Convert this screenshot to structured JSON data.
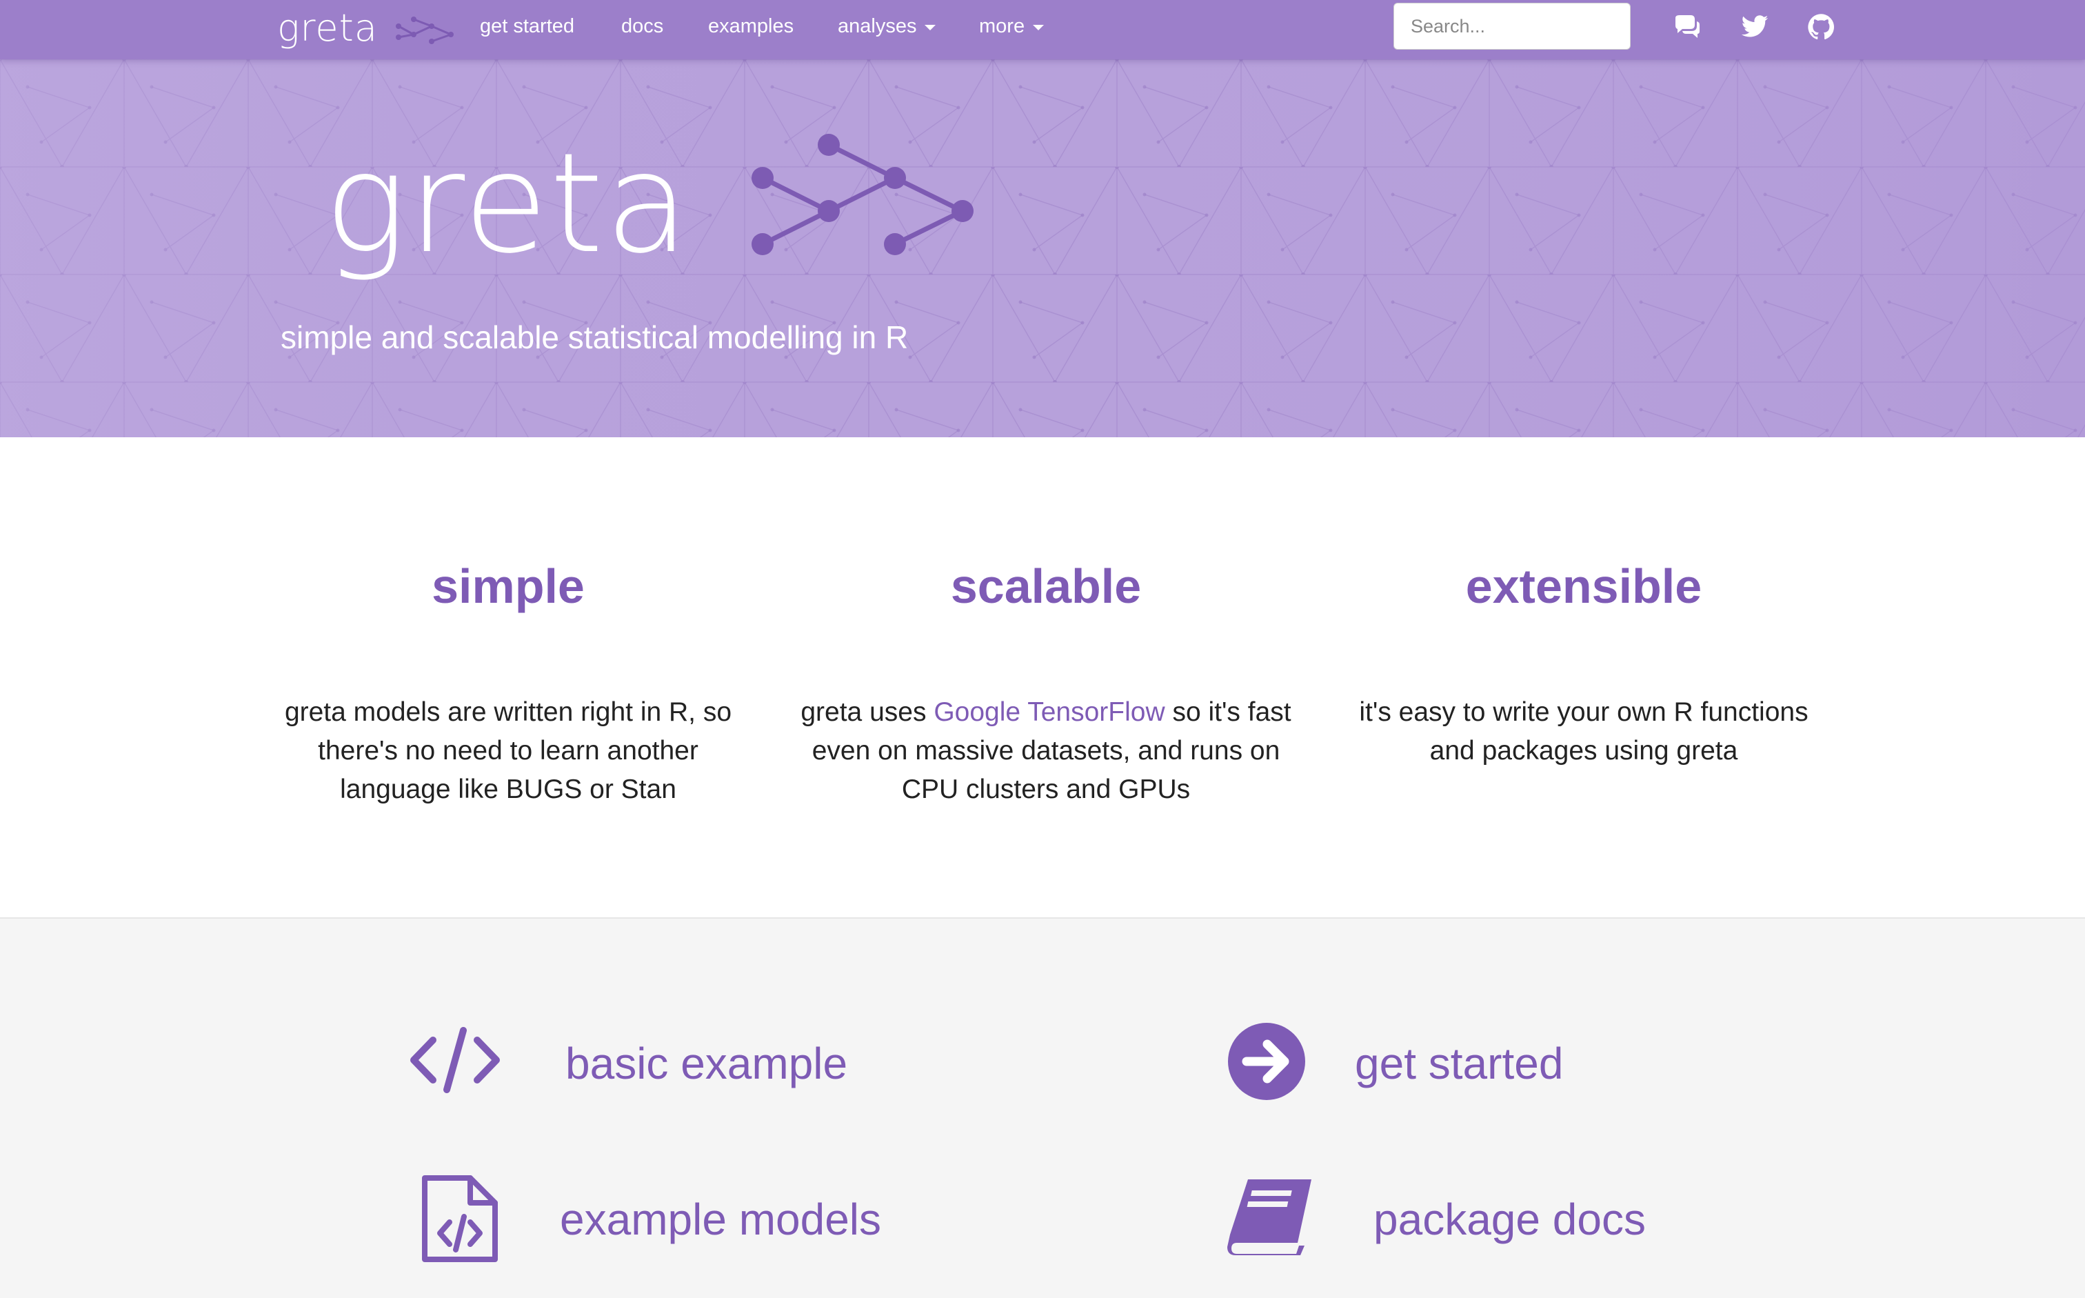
{
  "navbar": {
    "brand": "greta",
    "links": [
      {
        "label": "get started"
      },
      {
        "label": "docs"
      },
      {
        "label": "examples"
      },
      {
        "label": "analyses"
      },
      {
        "label": "more"
      }
    ],
    "search_placeholder": "Search...",
    "icons": [
      "comments-icon",
      "twitter-icon",
      "github-icon"
    ]
  },
  "hero": {
    "title": "greta",
    "tagline": "simple and scalable statistical modelling in R"
  },
  "features": [
    {
      "heading": "simple",
      "text": "greta models are written right in R, so there's no need to learn another language like BUGS or Stan"
    },
    {
      "heading": "scalable",
      "text_before": "greta uses ",
      "link": "Google TensorFlow",
      "text_after": " so it's fast even on massive datasets, and runs on CPU clusters and GPUs"
    },
    {
      "heading": "extensible",
      "text": "it's easy to write your own R functions and packages using greta"
    }
  ],
  "tiles": [
    {
      "label": "basic example",
      "icon": "code-icon"
    },
    {
      "label": "get started",
      "icon": "arrow-circle-right-icon"
    },
    {
      "label": "example models",
      "icon": "file-code-icon"
    },
    {
      "label": "package docs",
      "icon": "book-icon"
    }
  ],
  "colors": {
    "navbar": "#9c7fca",
    "hero": "#b7a1db",
    "accent": "#7e5bb5",
    "panel": "#f5f5f5"
  }
}
